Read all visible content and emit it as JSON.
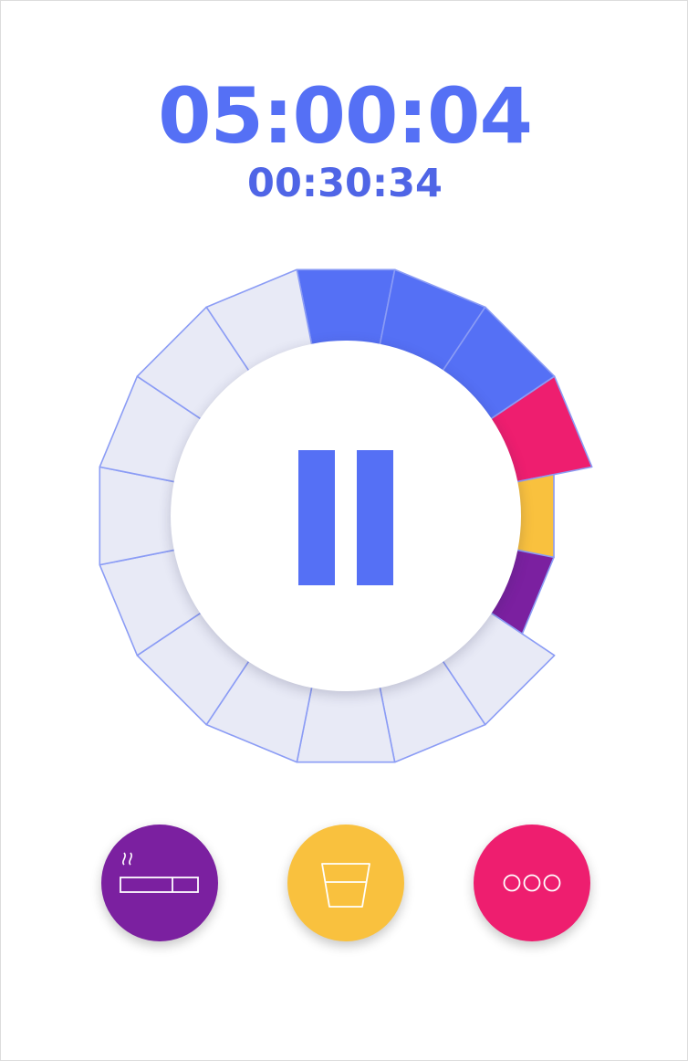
{
  "timer": {
    "main": "05:00:04",
    "sub": "00:30:34"
  },
  "dial": {
    "segment_count": 16,
    "segments": [
      {
        "status": "filled",
        "color": "#5570f5"
      },
      {
        "status": "filled",
        "color": "#5570f5"
      },
      {
        "status": "filled",
        "color": "#5570f5"
      },
      {
        "status": "event",
        "color": "#ee1e6f"
      },
      {
        "status": "event",
        "color": "#f9c13e"
      },
      {
        "status": "event",
        "color": "#7b20a0"
      },
      {
        "status": "empty",
        "color": "#e8eaf6"
      },
      {
        "status": "empty",
        "color": "#e8eaf6"
      },
      {
        "status": "empty",
        "color": "#e8eaf6"
      },
      {
        "status": "empty",
        "color": "#e8eaf6"
      },
      {
        "status": "empty",
        "color": "#e8eaf6"
      },
      {
        "status": "empty",
        "color": "#e8eaf6"
      },
      {
        "status": "empty",
        "color": "#e8eaf6"
      },
      {
        "status": "empty",
        "color": "#e8eaf6"
      },
      {
        "status": "empty",
        "color": "#e8eaf6"
      },
      {
        "status": "empty",
        "color": "#e8eaf6"
      }
    ],
    "event_segment_fractions": [
      1.0,
      0.5,
      0.5
    ],
    "outline_color": "#8b9cf5"
  },
  "controls": {
    "pause_icon": "pause-icon",
    "pause_color": "#5570f5"
  },
  "actions": [
    {
      "icon": "cigarette-icon",
      "color": "#7b20a0"
    },
    {
      "icon": "glass-icon",
      "color": "#f9c13e"
    },
    {
      "icon": "more-icon",
      "color": "#ee1e6f"
    }
  ],
  "colors": {
    "accent": "#5570f5",
    "empty": "#e8eaf6",
    "background": "#ffffff"
  }
}
